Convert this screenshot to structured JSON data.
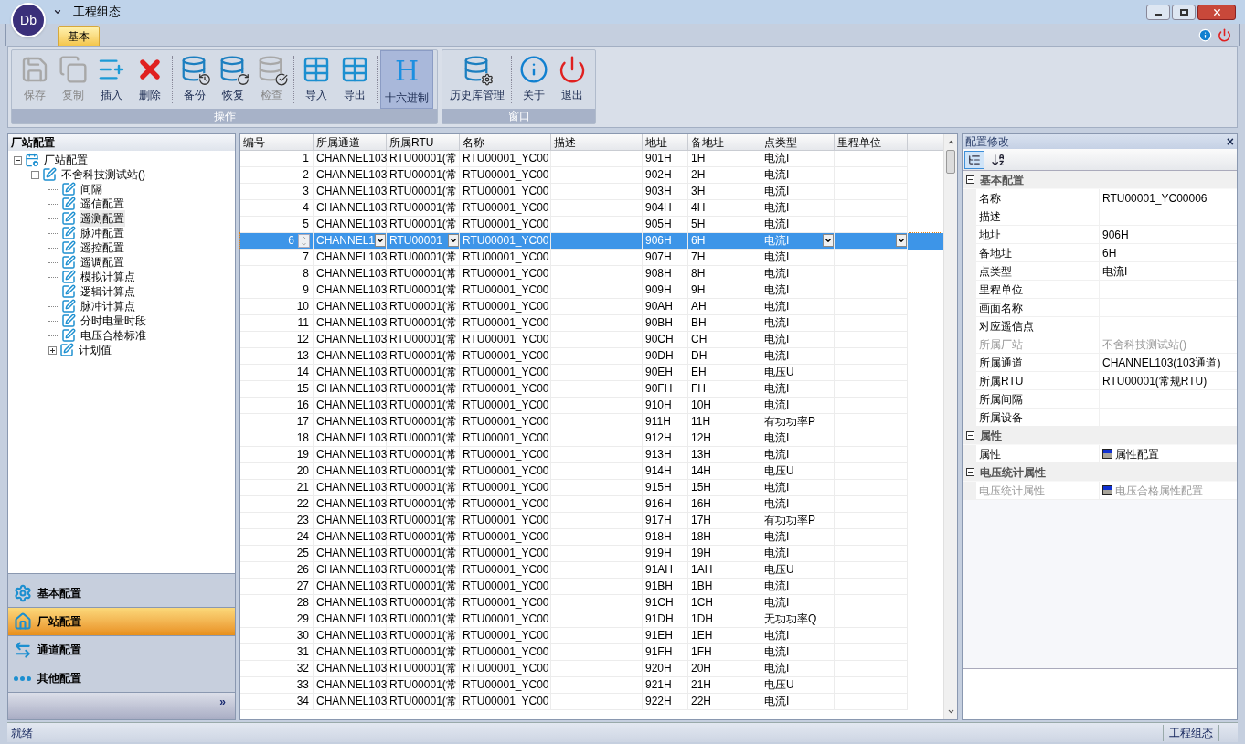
{
  "window": {
    "app_badge": "Db",
    "title": "工程组态",
    "tabs": [
      {
        "label": "基本",
        "selected": true
      }
    ]
  },
  "ribbon": {
    "groups": [
      {
        "label": "操作",
        "buttons": [
          {
            "label": "保存",
            "disabled": true,
            "selected": false
          },
          {
            "label": "复制",
            "disabled": true,
            "selected": false
          },
          {
            "label": "插入",
            "disabled": false,
            "selected": false
          },
          {
            "label": "删除",
            "disabled": false,
            "selected": false
          },
          {
            "label": "备份",
            "disabled": false,
            "selected": false
          },
          {
            "label": "恢复",
            "disabled": false,
            "selected": false
          },
          {
            "label": "检查",
            "disabled": true,
            "selected": false
          },
          {
            "label": "导入",
            "disabled": false,
            "selected": false
          },
          {
            "label": "导出",
            "disabled": false,
            "selected": false
          },
          {
            "label": "十六进制",
            "disabled": false,
            "selected": true,
            "glyph": "H"
          }
        ]
      },
      {
        "label": "窗口",
        "buttons": [
          {
            "label": "历史库管理",
            "disabled": false,
            "selected": false
          },
          {
            "label": "关于",
            "disabled": false,
            "selected": false
          },
          {
            "label": "退出",
            "disabled": false,
            "selected": false
          }
        ]
      }
    ]
  },
  "sidebar": {
    "title": "厂站配置",
    "tree": [
      {
        "label": "厂站配置",
        "kind": "root",
        "expanded": true,
        "selected": false,
        "children": [
          {
            "label": "不舍科技测试站()",
            "kind": "node",
            "expanded": true,
            "selected": false,
            "children": [
              {
                "label": "间隔",
                "kind": "node",
                "selected": false
              },
              {
                "label": "遥信配置",
                "kind": "node",
                "selected": false
              },
              {
                "label": "遥测配置",
                "kind": "node",
                "selected": true
              },
              {
                "label": "脉冲配置",
                "kind": "node",
                "selected": false
              },
              {
                "label": "遥控配置",
                "kind": "node",
                "selected": false
              },
              {
                "label": "遥调配置",
                "kind": "node",
                "selected": false
              },
              {
                "label": "模拟计算点",
                "kind": "node",
                "selected": false
              },
              {
                "label": "逻辑计算点",
                "kind": "node",
                "selected": false
              },
              {
                "label": "脉冲计算点",
                "kind": "node",
                "selected": false
              },
              {
                "label": "分时电量时段",
                "kind": "node",
                "selected": false
              },
              {
                "label": "电压合格标准",
                "kind": "node",
                "selected": false
              },
              {
                "label": "计划值",
                "kind": "node",
                "expanded": false,
                "selected": false
              }
            ]
          }
        ]
      }
    ],
    "nav": [
      {
        "label": "基本配置",
        "selected": false
      },
      {
        "label": "厂站配置",
        "selected": true
      },
      {
        "label": "通道配置",
        "selected": false
      },
      {
        "label": "其他配置",
        "selected": false
      }
    ],
    "nav_more": "»"
  },
  "table": {
    "columns": [
      "编号",
      "所属通道",
      "所属RTU",
      "名称",
      "描述",
      "地址",
      "备地址",
      "点类型",
      "里程单位"
    ],
    "rows": [
      {
        "no": "1",
        "channel": "CHANNEL103",
        "rtu": "RTU00001(常",
        "name": "RTU00001_YC00",
        "address": "901H",
        "backup_address": "1H",
        "point_type": "电流I",
        "selected": false
      },
      {
        "no": "2",
        "channel": "CHANNEL103",
        "rtu": "RTU00001(常",
        "name": "RTU00001_YC00",
        "address": "902H",
        "backup_address": "2H",
        "point_type": "电流I",
        "selected": false
      },
      {
        "no": "3",
        "channel": "CHANNEL103",
        "rtu": "RTU00001(常",
        "name": "RTU00001_YC00",
        "address": "903H",
        "backup_address": "3H",
        "point_type": "电流I",
        "selected": false
      },
      {
        "no": "4",
        "channel": "CHANNEL103",
        "rtu": "RTU00001(常",
        "name": "RTU00001_YC00",
        "address": "904H",
        "backup_address": "4H",
        "point_type": "电流I",
        "selected": false
      },
      {
        "no": "5",
        "channel": "CHANNEL103",
        "rtu": "RTU00001(常",
        "name": "RTU00001_YC00",
        "address": "905H",
        "backup_address": "5H",
        "point_type": "电流I",
        "selected": false
      },
      {
        "no": "6",
        "channel": "CHANNEL1",
        "rtu": "RTU00001",
        "name": "RTU00001_YC00",
        "address": "906H",
        "backup_address": "6H",
        "point_type": "电流I",
        "selected": true
      },
      {
        "no": "7",
        "channel": "CHANNEL103",
        "rtu": "RTU00001(常",
        "name": "RTU00001_YC00",
        "address": "907H",
        "backup_address": "7H",
        "point_type": "电流I",
        "selected": false
      },
      {
        "no": "8",
        "channel": "CHANNEL103",
        "rtu": "RTU00001(常",
        "name": "RTU00001_YC00",
        "address": "908H",
        "backup_address": "8H",
        "point_type": "电流I",
        "selected": false
      },
      {
        "no": "9",
        "channel": "CHANNEL103",
        "rtu": "RTU00001(常",
        "name": "RTU00001_YC00",
        "address": "909H",
        "backup_address": "9H",
        "point_type": "电流I",
        "selected": false
      },
      {
        "no": "10",
        "channel": "CHANNEL103",
        "rtu": "RTU00001(常",
        "name": "RTU00001_YC00",
        "address": "90AH",
        "backup_address": "AH",
        "point_type": "电流I",
        "selected": false
      },
      {
        "no": "11",
        "channel": "CHANNEL103",
        "rtu": "RTU00001(常",
        "name": "RTU00001_YC00",
        "address": "90BH",
        "backup_address": "BH",
        "point_type": "电流I",
        "selected": false
      },
      {
        "no": "12",
        "channel": "CHANNEL103",
        "rtu": "RTU00001(常",
        "name": "RTU00001_YC00",
        "address": "90CH",
        "backup_address": "CH",
        "point_type": "电流I",
        "selected": false
      },
      {
        "no": "13",
        "channel": "CHANNEL103",
        "rtu": "RTU00001(常",
        "name": "RTU00001_YC00",
        "address": "90DH",
        "backup_address": "DH",
        "point_type": "电流I",
        "selected": false
      },
      {
        "no": "14",
        "channel": "CHANNEL103",
        "rtu": "RTU00001(常",
        "name": "RTU00001_YC00",
        "address": "90EH",
        "backup_address": "EH",
        "point_type": "电压U",
        "selected": false
      },
      {
        "no": "15",
        "channel": "CHANNEL103",
        "rtu": "RTU00001(常",
        "name": "RTU00001_YC00",
        "address": "90FH",
        "backup_address": "FH",
        "point_type": "电流I",
        "selected": false
      },
      {
        "no": "16",
        "channel": "CHANNEL103",
        "rtu": "RTU00001(常",
        "name": "RTU00001_YC00",
        "address": "910H",
        "backup_address": "10H",
        "point_type": "电流I",
        "selected": false
      },
      {
        "no": "17",
        "channel": "CHANNEL103",
        "rtu": "RTU00001(常",
        "name": "RTU00001_YC00",
        "address": "911H",
        "backup_address": "11H",
        "point_type": "有功功率P",
        "selected": false
      },
      {
        "no": "18",
        "channel": "CHANNEL103",
        "rtu": "RTU00001(常",
        "name": "RTU00001_YC00",
        "address": "912H",
        "backup_address": "12H",
        "point_type": "电流I",
        "selected": false
      },
      {
        "no": "19",
        "channel": "CHANNEL103",
        "rtu": "RTU00001(常",
        "name": "RTU00001_YC00",
        "address": "913H",
        "backup_address": "13H",
        "point_type": "电流I",
        "selected": false
      },
      {
        "no": "20",
        "channel": "CHANNEL103",
        "rtu": "RTU00001(常",
        "name": "RTU00001_YC00",
        "address": "914H",
        "backup_address": "14H",
        "point_type": "电压U",
        "selected": false
      },
      {
        "no": "21",
        "channel": "CHANNEL103",
        "rtu": "RTU00001(常",
        "name": "RTU00001_YC00",
        "address": "915H",
        "backup_address": "15H",
        "point_type": "电流I",
        "selected": false
      },
      {
        "no": "22",
        "channel": "CHANNEL103",
        "rtu": "RTU00001(常",
        "name": "RTU00001_YC00",
        "address": "916H",
        "backup_address": "16H",
        "point_type": "电流I",
        "selected": false
      },
      {
        "no": "23",
        "channel": "CHANNEL103",
        "rtu": "RTU00001(常",
        "name": "RTU00001_YC00",
        "address": "917H",
        "backup_address": "17H",
        "point_type": "有功功率P",
        "selected": false
      },
      {
        "no": "24",
        "channel": "CHANNEL103",
        "rtu": "RTU00001(常",
        "name": "RTU00001_YC00",
        "address": "918H",
        "backup_address": "18H",
        "point_type": "电流I",
        "selected": false
      },
      {
        "no": "25",
        "channel": "CHANNEL103",
        "rtu": "RTU00001(常",
        "name": "RTU00001_YC00",
        "address": "919H",
        "backup_address": "19H",
        "point_type": "电流I",
        "selected": false
      },
      {
        "no": "26",
        "channel": "CHANNEL103",
        "rtu": "RTU00001(常",
        "name": "RTU00001_YC00",
        "address": "91AH",
        "backup_address": "1AH",
        "point_type": "电压U",
        "selected": false
      },
      {
        "no": "27",
        "channel": "CHANNEL103",
        "rtu": "RTU00001(常",
        "name": "RTU00001_YC00",
        "address": "91BH",
        "backup_address": "1BH",
        "point_type": "电流I",
        "selected": false
      },
      {
        "no": "28",
        "channel": "CHANNEL103",
        "rtu": "RTU00001(常",
        "name": "RTU00001_YC00",
        "address": "91CH",
        "backup_address": "1CH",
        "point_type": "电流I",
        "selected": false
      },
      {
        "no": "29",
        "channel": "CHANNEL103",
        "rtu": "RTU00001(常",
        "name": "RTU00001_YC00",
        "address": "91DH",
        "backup_address": "1DH",
        "point_type": "无功功率Q",
        "selected": false
      },
      {
        "no": "30",
        "channel": "CHANNEL103",
        "rtu": "RTU00001(常",
        "name": "RTU00001_YC00",
        "address": "91EH",
        "backup_address": "1EH",
        "point_type": "电流I",
        "selected": false
      },
      {
        "no": "31",
        "channel": "CHANNEL103",
        "rtu": "RTU00001(常",
        "name": "RTU00001_YC00",
        "address": "91FH",
        "backup_address": "1FH",
        "point_type": "电流I",
        "selected": false
      },
      {
        "no": "32",
        "channel": "CHANNEL103",
        "rtu": "RTU00001(常",
        "name": "RTU00001_YC00",
        "address": "920H",
        "backup_address": "20H",
        "point_type": "电流I",
        "selected": false
      },
      {
        "no": "33",
        "channel": "CHANNEL103",
        "rtu": "RTU00001(常",
        "name": "RTU00001_YC00",
        "address": "921H",
        "backup_address": "21H",
        "point_type": "电压U",
        "selected": false
      },
      {
        "no": "34",
        "channel": "CHANNEL103",
        "rtu": "RTU00001(常",
        "name": "RTU00001_YC00",
        "address": "922H",
        "backup_address": "22H",
        "point_type": "电流I",
        "selected": false
      }
    ]
  },
  "properties": {
    "title": "配置修改",
    "close": "×",
    "categories": [
      {
        "label": "基本配置",
        "expanded": true,
        "rows": [
          {
            "label": "名称",
            "value": "RTU00001_YC00006",
            "disabled": false
          },
          {
            "label": "描述",
            "disabled": false
          },
          {
            "label": "地址",
            "value": "906H",
            "disabled": false
          },
          {
            "label": "备地址",
            "value": "6H",
            "disabled": false
          },
          {
            "label": "点类型",
            "value": "电流I",
            "disabled": false
          },
          {
            "label": "里程单位",
            "disabled": false
          },
          {
            "label": "画面名称",
            "disabled": false
          },
          {
            "label": "对应遥信点",
            "disabled": false
          },
          {
            "label": "所属厂站",
            "value": "不舍科技测试站()",
            "disabled": true
          },
          {
            "label": "所属通道",
            "value": "CHANNEL103(103通道)",
            "disabled": false
          },
          {
            "label": "所属RTU",
            "value": "RTU00001(常规RTU)",
            "disabled": false
          },
          {
            "label": "所属间隔",
            "disabled": false
          },
          {
            "label": "所属设备",
            "disabled": false
          }
        ]
      },
      {
        "label": "属性",
        "expanded": true,
        "rows": [
          {
            "label": "属性",
            "value": "属性配置",
            "kind": "swatch",
            "disabled": false
          }
        ]
      },
      {
        "label": "电压统计属性",
        "expanded": true,
        "rows": [
          {
            "label": "电压统计属性",
            "value": "电压合格属性配置",
            "kind": "swatch",
            "disabled": true
          }
        ]
      }
    ]
  },
  "status_bar": {
    "left": "就绪",
    "right": "工程组态"
  }
}
